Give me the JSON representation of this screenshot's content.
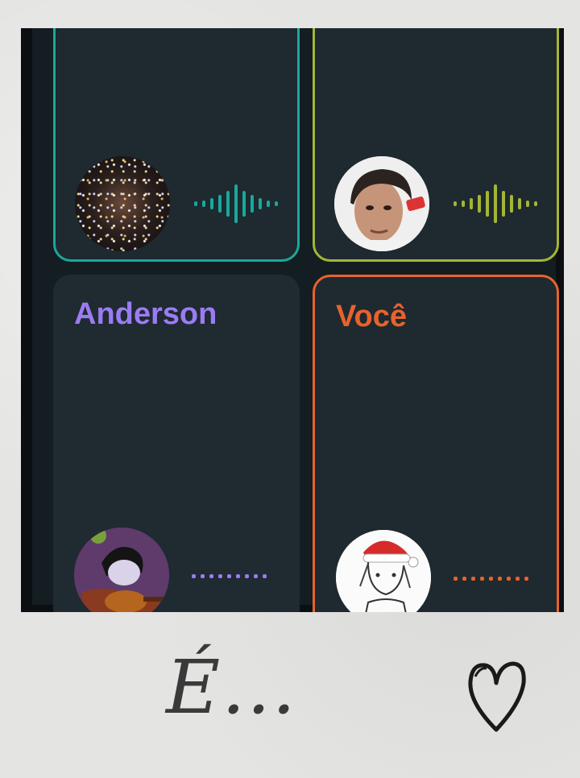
{
  "participants": [
    {
      "name": "",
      "accent": "#1aa89a",
      "avatar": "galaxy-avatar",
      "audio": "speaking"
    },
    {
      "name": "",
      "accent": "#a4b633",
      "avatar": "boy-photo-avatar",
      "audio": "speaking"
    },
    {
      "name": "Anderson",
      "accent": "#9a7cf2",
      "avatar": "cartoon-avatar",
      "audio": "silent"
    },
    {
      "name": "Você",
      "accent": "#e8622c",
      "avatar": "santa-sketch-avatar",
      "audio": "silent"
    }
  ],
  "caption": "É...",
  "decoration": "heart-doodle-icon"
}
